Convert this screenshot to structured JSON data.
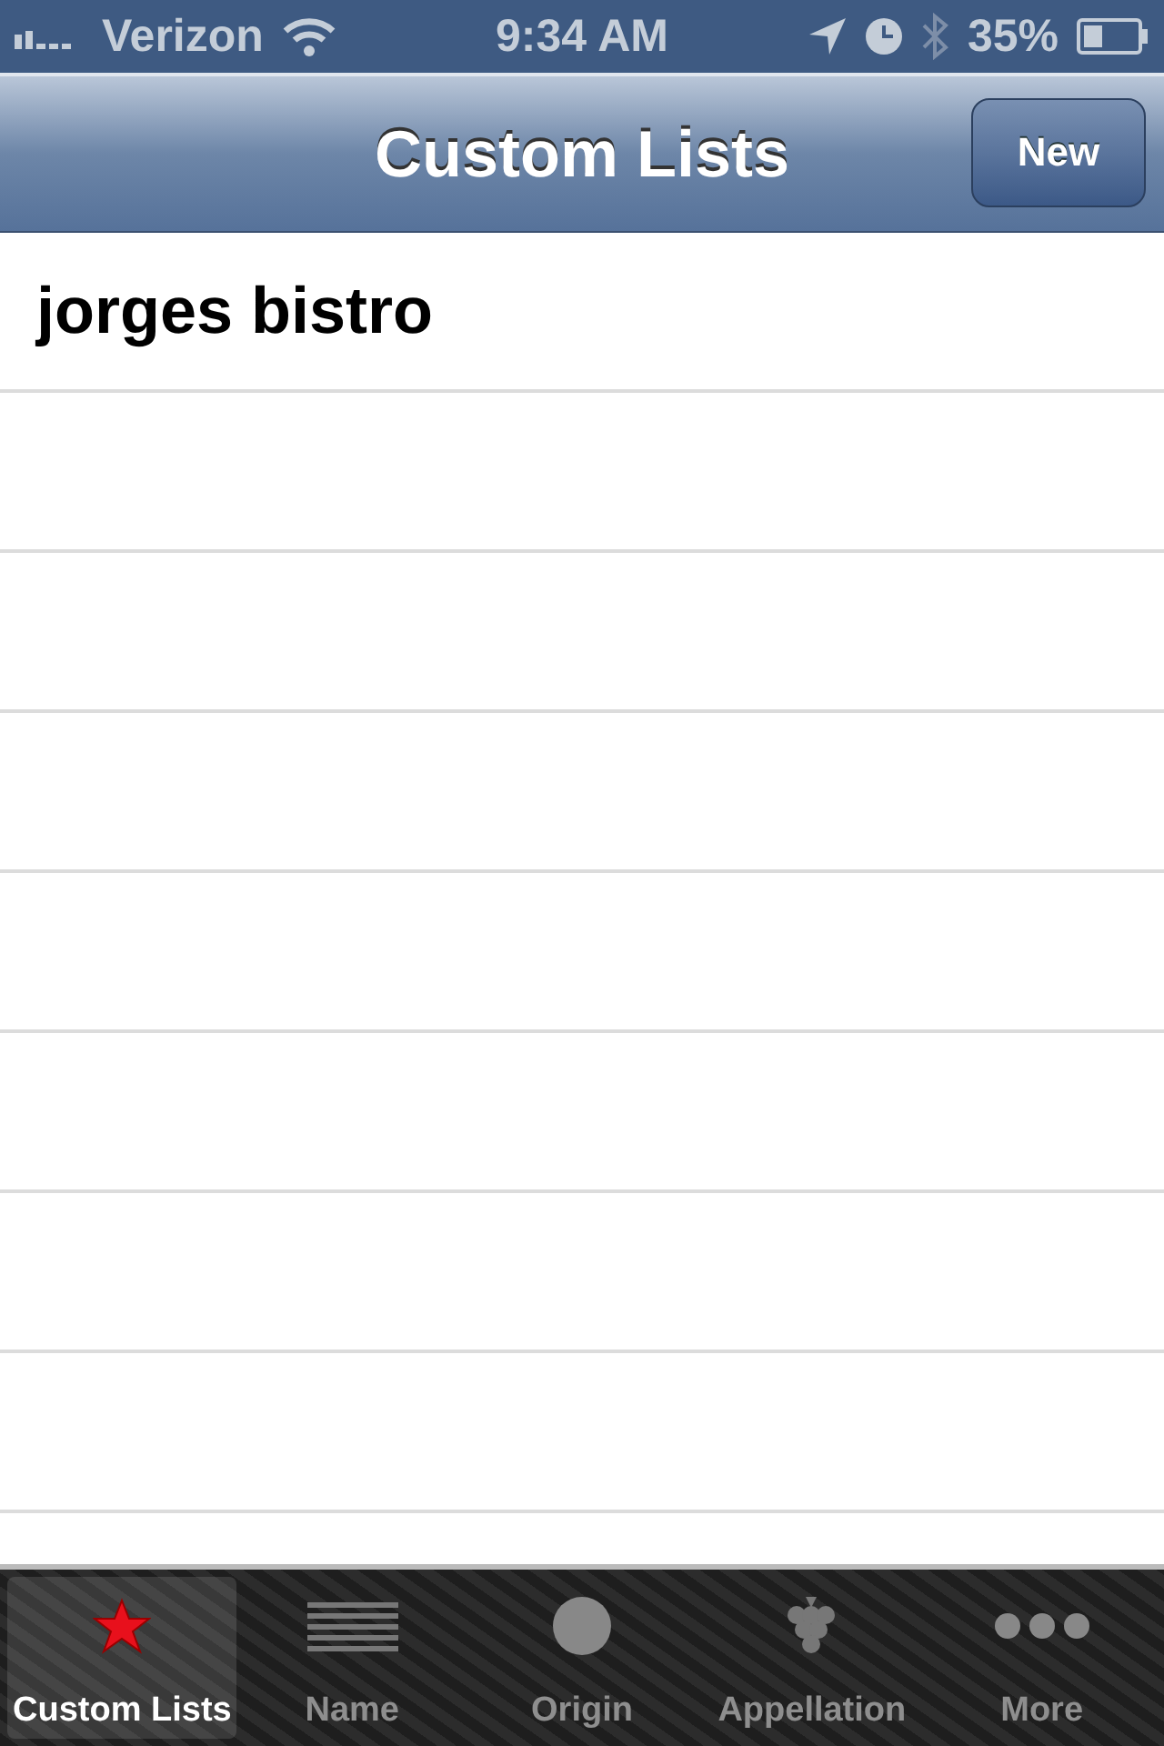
{
  "status_bar": {
    "carrier": "Verizon",
    "time": "9:34 AM",
    "battery": "35%"
  },
  "nav_bar": {
    "title": "Custom Lists",
    "new_button": "New"
  },
  "rows": [
    {
      "title": "jorges bistro"
    }
  ],
  "tabs": [
    {
      "label": "Custom Lists",
      "kind": "star",
      "selected": true
    },
    {
      "label": "Name",
      "kind": "lines",
      "selected": false
    },
    {
      "label": "Origin",
      "kind": "circle",
      "selected": false
    },
    {
      "label": "Appellation",
      "kind": "grapes",
      "selected": false
    },
    {
      "label": "More",
      "kind": "dots",
      "selected": false
    }
  ]
}
